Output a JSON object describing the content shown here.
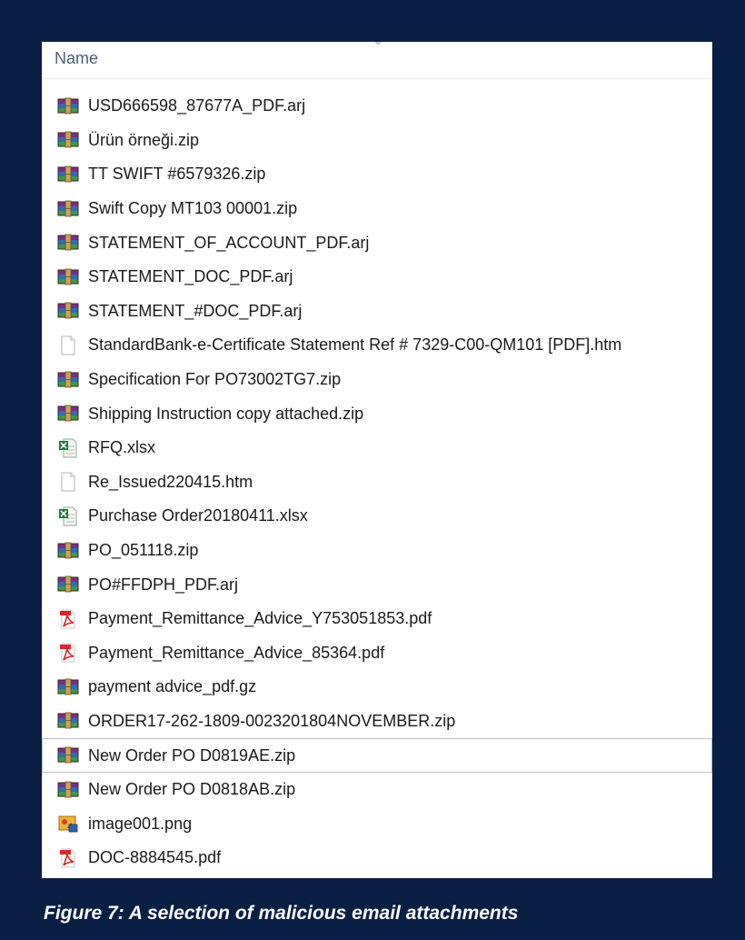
{
  "header": {
    "name_label": "Name"
  },
  "files": [
    {
      "name": "USD666598_87677A_PDF.arj",
      "icon": "winrar-archive-icon"
    },
    {
      "name": "Ürün örneği.zip",
      "icon": "winrar-archive-icon"
    },
    {
      "name": "TT SWIFT #6579326.zip",
      "icon": "winrar-archive-icon"
    },
    {
      "name": "Swift Copy MT103 00001.zip",
      "icon": "winrar-archive-icon"
    },
    {
      "name": "STATEMENT_OF_ACCOUNT_PDF.arj",
      "icon": "winrar-archive-icon"
    },
    {
      "name": "STATEMENT_DOC_PDF.arj",
      "icon": "winrar-archive-icon"
    },
    {
      "name": "STATEMENT_#DOC_PDF.arj",
      "icon": "winrar-archive-icon"
    },
    {
      "name": "StandardBank-e-Certificate Statement Ref # 7329-C00-QM101 [PDF].htm",
      "icon": "blank-document-icon"
    },
    {
      "name": "Specification For PO73002TG7.zip",
      "icon": "winrar-archive-icon"
    },
    {
      "name": "Shipping Instruction copy attached.zip",
      "icon": "winrar-archive-icon"
    },
    {
      "name": "RFQ.xlsx",
      "icon": "excel-document-icon"
    },
    {
      "name": "Re_Issued220415.htm",
      "icon": "blank-document-icon"
    },
    {
      "name": "Purchase Order20180411.xlsx",
      "icon": "excel-document-icon"
    },
    {
      "name": "PO_051118.zip",
      "icon": "winrar-archive-icon"
    },
    {
      "name": "PO#FFDPH_PDF.arj",
      "icon": "winrar-archive-icon"
    },
    {
      "name": "Payment_Remittance_Advice_Y753051853.pdf",
      "icon": "pdf-document-icon"
    },
    {
      "name": "Payment_Remittance_Advice_85364.pdf",
      "icon": "pdf-document-icon"
    },
    {
      "name": "payment advice_pdf.gz",
      "icon": "winrar-archive-icon"
    },
    {
      "name": "ORDER17-262-1809-0023201804NOVEMBER.zip",
      "icon": "winrar-archive-icon"
    },
    {
      "name": "New Order PO D0819AE.zip",
      "icon": "winrar-archive-icon",
      "selected": true
    },
    {
      "name": "New Order PO D0818AB.zip",
      "icon": "winrar-archive-icon"
    },
    {
      "name": "image001.png",
      "icon": "image-file-icon"
    },
    {
      "name": "DOC-8884545.pdf",
      "icon": "pdf-document-icon"
    }
  ],
  "caption": "Figure 7: A selection of malicious email attachments",
  "colors": {
    "frame_background": "#0a1f44",
    "panel_background": "#ffffff",
    "header_text": "#4c607a",
    "file_text": "#1a1a1a",
    "selection_border": "#b8c3cf",
    "caption_text": "#ffffff"
  }
}
